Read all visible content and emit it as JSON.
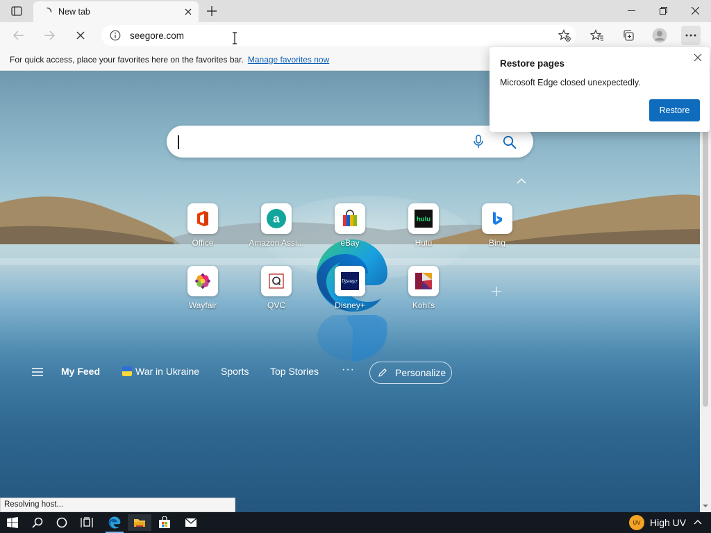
{
  "browser": {
    "tab": {
      "title": "New tab"
    },
    "address": {
      "url": "seegore.com"
    },
    "favorites_bar": {
      "message": "For quick access, place your favorites here on the favorites bar.",
      "link": "Manage favorites now"
    }
  },
  "newtab": {
    "search": {
      "placeholder": ""
    },
    "quick_links": [
      {
        "label": "Office",
        "icon": "office-icon"
      },
      {
        "label": "Amazon Assi...",
        "icon": "amazon-icon"
      },
      {
        "label": "eBay",
        "icon": "ebay-icon"
      },
      {
        "label": "Hulu",
        "icon": "hulu-icon"
      },
      {
        "label": "Bing",
        "icon": "bing-icon"
      },
      {
        "label": "Wayfair",
        "icon": "wayfair-icon"
      },
      {
        "label": "QVC",
        "icon": "qvc-icon"
      },
      {
        "label": "Disney+",
        "icon": "disney-icon"
      },
      {
        "label": "Kohl's",
        "icon": "kohls-icon"
      }
    ],
    "feed": {
      "items": [
        "My Feed",
        "War in Ukraine",
        "Sports",
        "Top Stories"
      ],
      "more": "···",
      "personalize": "Personalize"
    }
  },
  "popup": {
    "title": "Restore pages",
    "body": "Microsoft Edge closed unexpectedly.",
    "button": "Restore"
  },
  "status": {
    "text": "Resolving host..."
  },
  "taskbar": {
    "weather": {
      "badge": "UV",
      "label": "High UV"
    }
  },
  "colors": {
    "accent": "#0f6cbd",
    "link": "#0a5fb4"
  }
}
